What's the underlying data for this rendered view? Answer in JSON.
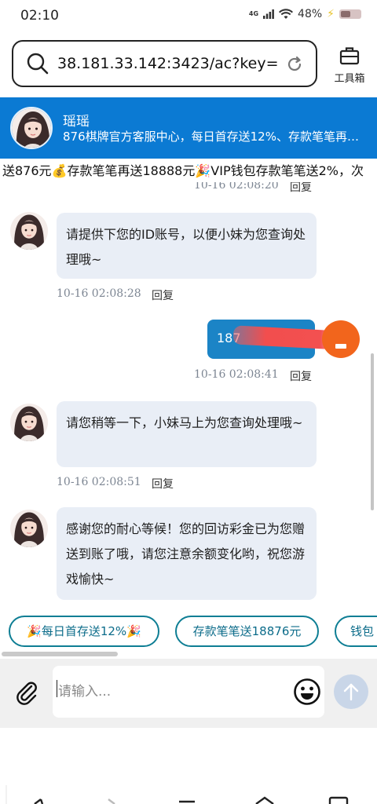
{
  "status": {
    "time": "02:10",
    "network": "4G",
    "battery": "48%"
  },
  "browser": {
    "url": "38.181.33.142:3423/ac?key=···",
    "toolbox_label": "工具箱"
  },
  "header": {
    "name": "瑶瑶",
    "subtitle": "876棋牌官方客服中心，每日首存送12%、存款笔笔再…"
  },
  "marquee": "送876元💰存款笔笔再送18888元🎉VIP钱包存款笔笔送2%，次",
  "messages": [
    {
      "time": "10-16 02:08:20",
      "reply": "回复"
    },
    {
      "text": "请提供下您的ID账号，以便小妹为您查询处理哦~",
      "time": "10-16 02:08:28",
      "reply": "回复"
    },
    {
      "text": "187",
      "time": "10-16 02:08:41",
      "reply": "回复"
    },
    {
      "text": "请您稍等一下，小妹马上为您查询处理哦~",
      "time": "10-16 02:08:51",
      "reply": "回复"
    },
    {
      "text": "感谢您的耐心等候！您的回访彩金已为您赠送到账了哦，请您注意余额变化哟，祝您游戏愉快~"
    }
  ],
  "quick_replies": [
    "🎉每日首存送12%🎉",
    "存款笔笔送18876元",
    "钱包"
  ],
  "input": {
    "placeholder": "请输入..."
  },
  "colors": {
    "header_bg": "#0b7ad3",
    "bubble_in": "#e9eef6",
    "bubble_out": "#1b84c6",
    "chip_border": "#0e7e94",
    "send_button": "#c9d6e8"
  }
}
